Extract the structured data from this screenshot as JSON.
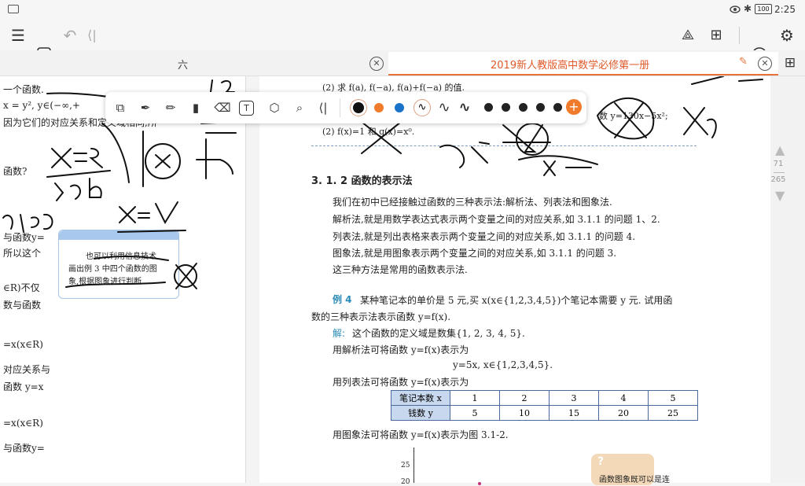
{
  "status_bar": {
    "time": "2:25",
    "battery": "100"
  },
  "tabs": {
    "left_label": "六",
    "right_label": "2019新人教版高中数学必修第一册"
  },
  "left_page": {
    "lines": [
      "一个函数.",
      "x = y², y∈(−∞,+",
      "因为它们的对应关系和定义域相同,所",
      "函数?",
      "与函数y=",
      "所以这个",
      "∈R)不仅",
      "数与函数",
      "=x(x∈R)",
      "对应关系与",
      "函数 y=x",
      "=x(x∈R)",
      "与函数y="
    ],
    "note": [
      "也可以利用信息技术",
      "画出例 3 中四个函数的图",
      "象,根据图象进行判断."
    ]
  },
  "right_page": {
    "problem_line": "(2) 求 f(a), f(−a), f(a)+f(−a) 的值.",
    "problem_line2": "(2) f(x)=1 和 g(x)=x⁰.",
    "side_formula": "数 y=130x−5x²;",
    "section_title": "3. 1. 2  函数的表示法",
    "paragraphs": [
      "我们在初中已经接触过函数的三种表示法:解析法、列表法和图象法.",
      "解析法,就是用数学表达式表示两个变量之间的对应关系,如 3.1.1 的问题 1、2.",
      "列表法,就是列出表格来表示两个变量之间的对应关系,如 3.1.1 的问题 4.",
      "图象法,就是用图象表示两个变量之间的对应关系,如 3.1.1 的问题 3.",
      "这三种方法是常用的函数表示法."
    ],
    "example_label": "例 4",
    "example_text": "某种笔记本的单价是 5 元,买 x(x∈{1,2,3,4,5})个笔记本需要 y 元. 试用函",
    "example_text2": "数的三种表示法表示函数 y=f(x).",
    "solution_label": "解:",
    "solution_text": "这个函数的定义域是数集{1, 2, 3, 4, 5}.",
    "analytic_line": "用解析法可将函数 y=f(x)表示为",
    "formula": "y=5x, x∈{1,2,3,4,5}.",
    "table_line": "用列表法可将函数 y=f(x)表示为",
    "table": {
      "header_row": [
        "笔记本数 x",
        "1",
        "2",
        "3",
        "4",
        "5"
      ],
      "value_row": [
        "钱数 y",
        "5",
        "10",
        "15",
        "20",
        "25"
      ]
    },
    "graph_line": "用图象法可将函数 y=f(x)表示为图 3.1-2.",
    "graph_ticks": [
      "25",
      "20"
    ],
    "hint_icon": "?",
    "hint_text": "函数图象既可以是连"
  },
  "scroll": {
    "current_page": "71",
    "total_pages": "265"
  },
  "colors": {
    "accent": "#e8733a",
    "tab_text": "#e15a2b",
    "table_border": "#4a6a9a",
    "pen_black": "#111111"
  },
  "ann_toolbar": {
    "tools": [
      "lasso-icon",
      "pen-icon",
      "pencil-icon",
      "highlighter-icon",
      "eraser-icon",
      "text-icon",
      "shape-icon",
      "search-icon",
      "undo-icon"
    ],
    "colors": [
      "#111111",
      "#f07b2a",
      "#1a73c8"
    ]
  }
}
